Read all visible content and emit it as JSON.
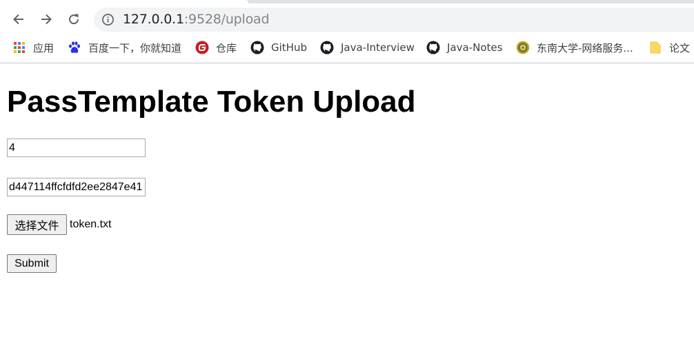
{
  "browser": {
    "url_host": "127.0.0.1",
    "url_path": ":9528/upload",
    "bookmarks": [
      {
        "label": "应用",
        "icon": "apps-grid-icon"
      },
      {
        "label": "百度一下，你就知道",
        "icon": "baidu-paw-icon"
      },
      {
        "label": "仓库",
        "icon": "gitee-icon"
      },
      {
        "label": "GitHub",
        "icon": "github-icon"
      },
      {
        "label": "Java-Interview",
        "icon": "github-icon"
      },
      {
        "label": "Java-Notes",
        "icon": "github-icon"
      },
      {
        "label": "东南大学-网络服务...",
        "icon": "university-seal-icon"
      },
      {
        "label": "论文",
        "icon": "folder-icon"
      }
    ]
  },
  "page": {
    "title": "PassTemplate Token Upload",
    "field_1_value": "4",
    "field_2_value": "d447114ffcfdfd2ee2847e41",
    "file_button_label": "选择文件",
    "file_name": "token.txt",
    "submit_label": "Submit"
  },
  "colors": {
    "omnibox_bg": "#f1f3f4",
    "url_host": "#202124",
    "url_path": "#80868b",
    "button_bg": "#efefef"
  }
}
